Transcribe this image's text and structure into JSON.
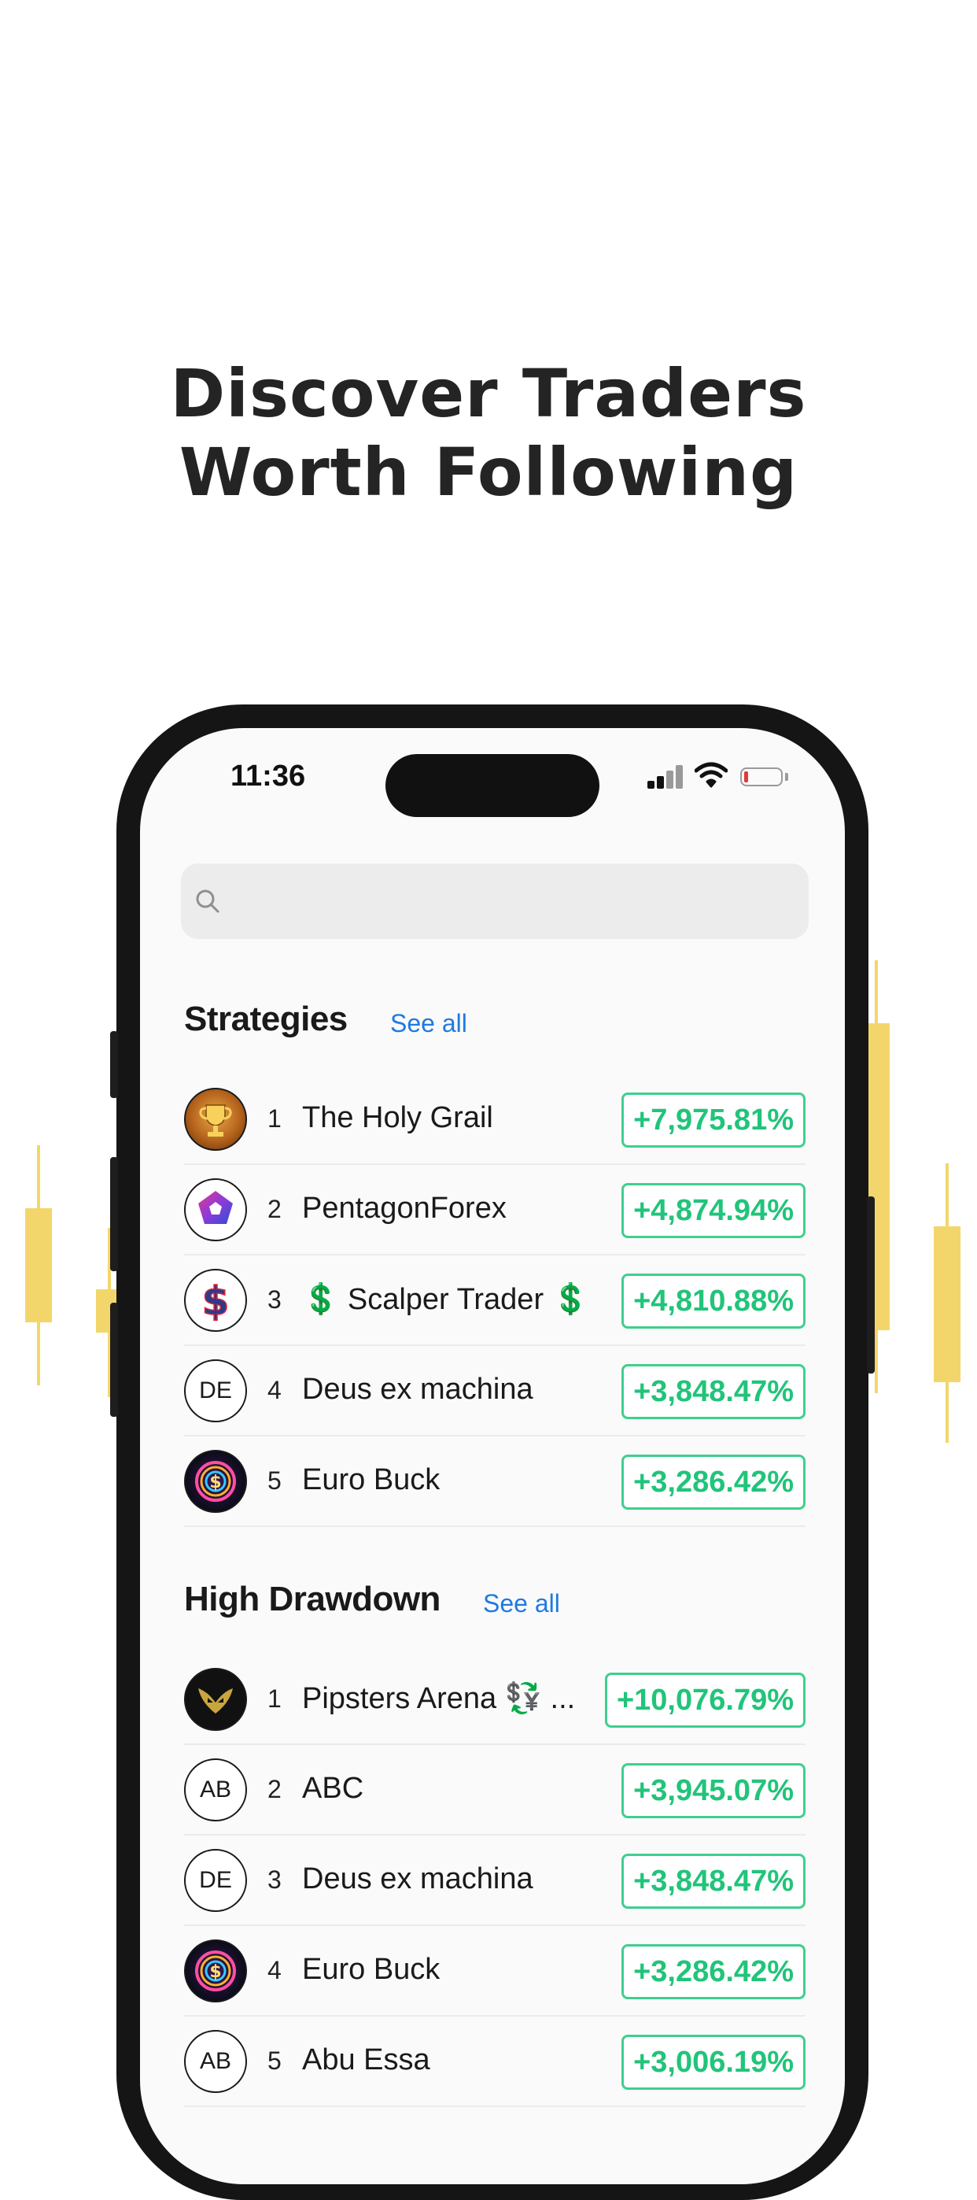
{
  "headline": {
    "line1": "Discover Traders",
    "line2": "Worth Following"
  },
  "status_bar": {
    "time": "11:36",
    "icons": [
      "cellular-signal-icon",
      "wifi-icon",
      "battery-low-icon"
    ],
    "battery_color": "#e03b3b"
  },
  "search": {
    "placeholder": "",
    "value": "",
    "icon": "search-icon"
  },
  "colors": {
    "accent": "#1f7ae0",
    "positive": "#21c47a",
    "candle": "#f3d66b"
  },
  "strategies": {
    "title": "Strategies",
    "see_all": "See all",
    "items": [
      {
        "rank": "1",
        "name": "The Holy Grail",
        "change": "+7,975.81%",
        "avatar": "trophy-icon"
      },
      {
        "rank": "2",
        "name": "PentagonForex",
        "change": "+4,874.94%",
        "avatar": "pentagon-logo"
      },
      {
        "rank": "3",
        "name": "💲 Scalper Trader 💲",
        "change": "+4,810.88%",
        "avatar": "dollar-sign-logo"
      },
      {
        "rank": "4",
        "name": "Deus ex machina",
        "change": "+3,848.47%",
        "avatar_initials": "DE"
      },
      {
        "rank": "5",
        "name": "Euro Buck",
        "change": "+3,286.42%",
        "avatar": "neon-coin-logo"
      }
    ]
  },
  "high_drawdown": {
    "title": "High Drawdown",
    "see_all": "See all",
    "items": [
      {
        "rank": "1",
        "name": "Pipsters Arena 💱 ...",
        "change": "+10,076.79%",
        "avatar": "golden-mask-logo"
      },
      {
        "rank": "2",
        "name": "ABC",
        "change": "+3,945.07%",
        "avatar_initials": "AB"
      },
      {
        "rank": "3",
        "name": "Deus ex machina",
        "change": "+3,848.47%",
        "avatar_initials": "DE"
      },
      {
        "rank": "4",
        "name": "Euro Buck",
        "change": "+3,286.42%",
        "avatar": "neon-coin-logo"
      },
      {
        "rank": "5",
        "name": "Abu Essa",
        "change": "+3,006.19%",
        "avatar_initials": "AB"
      }
    ]
  }
}
